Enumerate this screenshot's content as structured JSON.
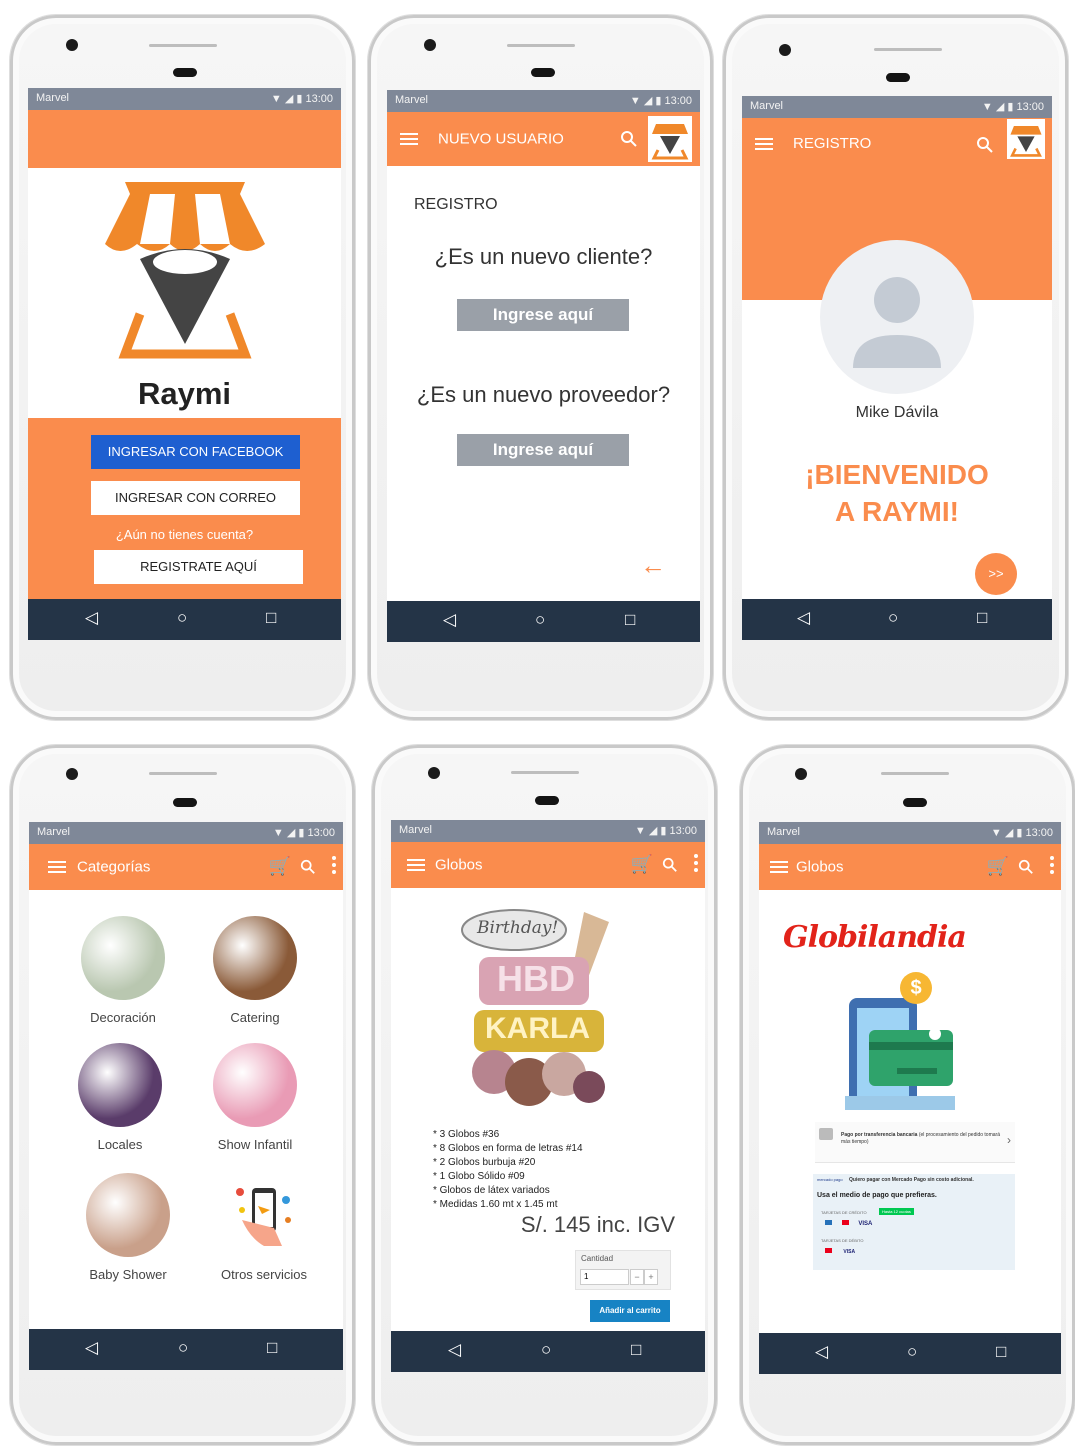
{
  "status": {
    "carrier": "Marvel",
    "time": "13:00",
    "icons": "▼ ◢ ▮"
  },
  "nav": {
    "back": "◁",
    "home": "○",
    "recent": "□"
  },
  "login": {
    "brand": "Raymi",
    "facebook": "INGRESAR CON FACEBOOK",
    "email": "INGRESAR CON CORREO",
    "no_account": "¿Aún no tienes cuenta?",
    "register": "REGISTRATE AQUÍ"
  },
  "new_user": {
    "appbar_title": "NUEVO USUARIO",
    "section": "REGISTRO",
    "q_client": "¿Es un nuevo cliente?",
    "btn_client": "Ingrese aquí",
    "q_provider": "¿Es un nuevo proveedor?",
    "btn_provider": "Ingrese aquí",
    "back_arrow": "←"
  },
  "welcome": {
    "appbar_title": "REGISTRO",
    "name": "Mike Dávila",
    "line1": "¡BIENVENIDO",
    "line2": "A RAYMI!",
    "next": ">>"
  },
  "categories": {
    "appbar_title": "Categorías",
    "items": [
      {
        "label": "Decoración",
        "color": "#b9c7b0"
      },
      {
        "label": "Catering",
        "color": "#8a5a38"
      },
      {
        "label": "Locales",
        "color": "#5a3c6a"
      },
      {
        "label": "Show Infantil",
        "color": "#e99bb5"
      },
      {
        "label": "Baby Shower",
        "color": "#c9a08a"
      },
      {
        "label": "Otros servicios",
        "color": "#f2f2f2"
      }
    ]
  },
  "product": {
    "appbar_title": "Globos",
    "image_text1": "Birthday!",
    "image_text2": "HBD",
    "image_text3": "KARLA",
    "details": [
      "* 3 Globos #36",
      "* 8 Globos en forma de letras #14",
      "* 2 Globos burbuja #20",
      "* 1 Globo Sólido #09",
      "* Globos de látex variados",
      "* Medidas 1.60 mt x 1.45 mt"
    ],
    "price": "S/. 145 inc. IGV",
    "qty_label": "Cantidad",
    "qty_value": "1",
    "minus": "−",
    "plus": "+",
    "add_cart": "Añadir al carrito"
  },
  "payment": {
    "appbar_title": "Globos",
    "brand": "Globilandia",
    "dollar": "$",
    "transfer_bold": "Pago por transferencia bancaria",
    "transfer_rest": "(el procesamiento del pedido tomará más tiempo)",
    "mp_logo": "mercado pago",
    "mp_text": "Quiero pagar con Mercado Pago sin costo adicional.",
    "mp_prompt": "Usa el medio de pago que prefieras.",
    "credit": "TARJETAS DE CRÉDITO",
    "credit_badge": "Hasta 12 cuotas",
    "visa1": "VISA",
    "debit": "TARJETAS DE DÉBITO",
    "visa2": "VISA"
  },
  "colors": {
    "orange": "#fa8c4d",
    "navbar": "#243447",
    "facebook": "#1e5fd0",
    "cart_blue": "#1783c4"
  }
}
